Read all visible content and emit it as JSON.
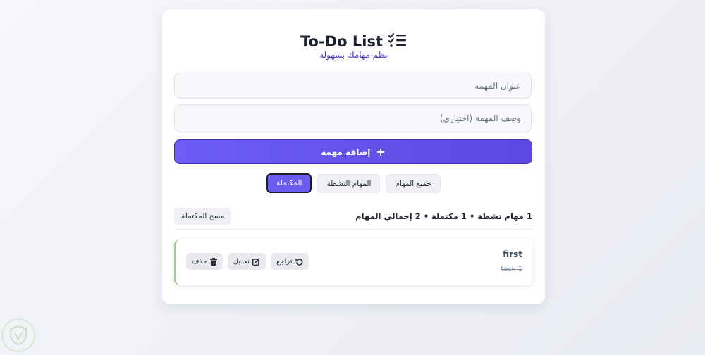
{
  "header": {
    "title": "To-Do List",
    "title_icon": "list-check-icon",
    "subtitle": "تظم مهامك بسهولة"
  },
  "form": {
    "title_placeholder": "عنوان المهمة",
    "description_placeholder": "وصف المهمة (اختياري)",
    "add_button_label": "إضافة مهمة"
  },
  "filters": [
    {
      "label": "جميع المهام",
      "active": false
    },
    {
      "label": "المهام النشطة",
      "active": false
    },
    {
      "label": "المكتملة",
      "active": true
    }
  ],
  "stats": {
    "summary": "1 مهام نشطة • 1 مكتملة • 2 إجمالي المهام",
    "clear_completed_label": "مسح المكتملة"
  },
  "tasks": [
    {
      "title": "first",
      "description": "task 1",
      "completed": true,
      "actions": {
        "undo": "تراجع",
        "edit": "تعديل",
        "delete": "حذف"
      }
    }
  ],
  "colors": {
    "accent": "#6b5cf0",
    "subtitle": "#4b3cd0",
    "completed_border": "#a5c98a"
  }
}
